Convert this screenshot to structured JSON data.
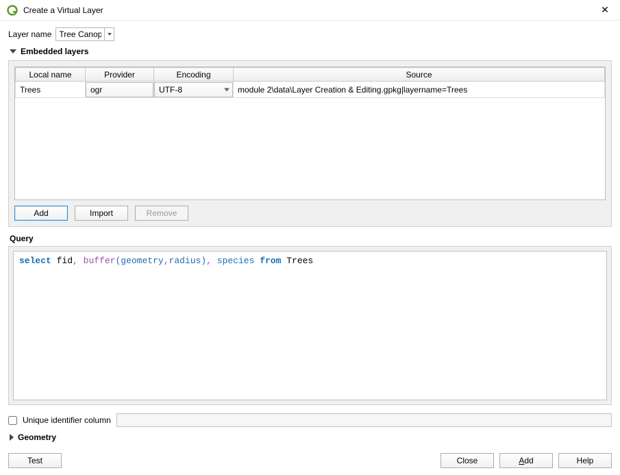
{
  "window": {
    "title": "Create a Virtual Layer"
  },
  "layerName": {
    "label": "Layer name",
    "value": "Tree Canopy"
  },
  "embedded": {
    "header": "Embedded layers",
    "columns": {
      "local": "Local name",
      "provider": "Provider",
      "encoding": "Encoding",
      "source": "Source"
    },
    "rows": [
      {
        "local": "Trees",
        "provider": "ogr",
        "encoding": "UTF-8",
        "source": "module 2\\data\\Layer Creation & Editing.gpkg|layername=Trees"
      }
    ],
    "buttons": {
      "add": "Add",
      "import": "Import",
      "remove": "Remove"
    }
  },
  "query": {
    "label": "Query",
    "tokens": {
      "select": "select",
      "fid": "fid",
      "buffer": "buffer",
      "geometry": "geometry",
      "radius": "radius",
      "species": "species",
      "from": "from",
      "trees": "Trees"
    }
  },
  "uid": {
    "label": "Unique identifier column"
  },
  "geometry": {
    "header": "Geometry"
  },
  "bottom": {
    "test": "Test",
    "close": "Close",
    "add": "Add",
    "addUnderline": "A",
    "addRest": "dd",
    "help": "Help"
  }
}
